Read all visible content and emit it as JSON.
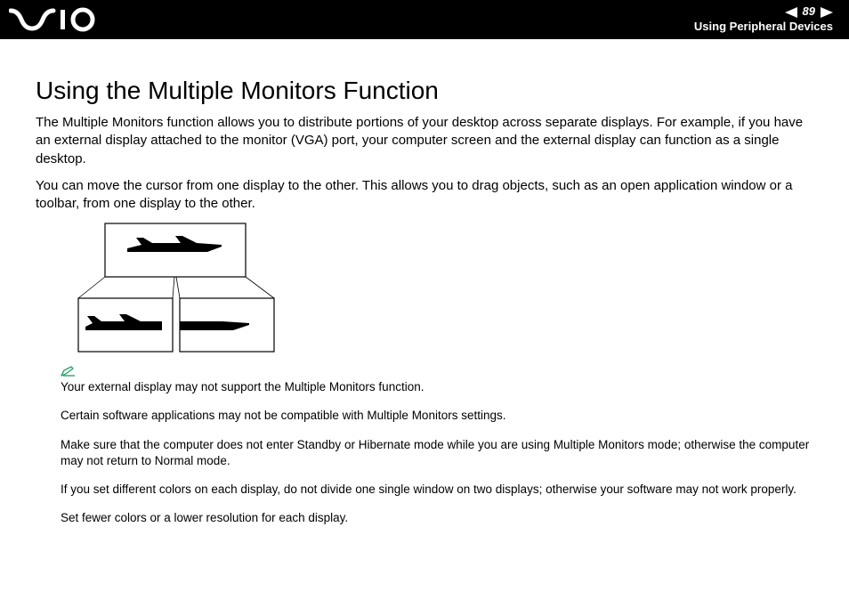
{
  "header": {
    "page_number": "89",
    "section": "Using Peripheral Devices"
  },
  "content": {
    "heading": "Using the Multiple Monitors Function",
    "para1": "The Multiple Monitors function allows you to distribute portions of your desktop across separate displays. For example, if you have an external display attached to the monitor (VGA) port, your computer screen and the external display can function as a single desktop.",
    "para2": "You can move the cursor from one display to the other. This allows you to drag objects, such as an open application window or a toolbar, from one display to the other.",
    "note1": "Your external display may not support the Multiple Monitors function.",
    "note2": "Certain software applications may not be compatible with Multiple Monitors settings.",
    "note3": "Make sure that the computer does not enter Standby or Hibernate mode while you are using Multiple Monitors mode; otherwise the computer may not return to Normal mode.",
    "note4": "If you set different colors on each display, do not divide one single window on two displays; otherwise your software may not work properly.",
    "note5": "Set fewer colors or a lower resolution for each display."
  }
}
